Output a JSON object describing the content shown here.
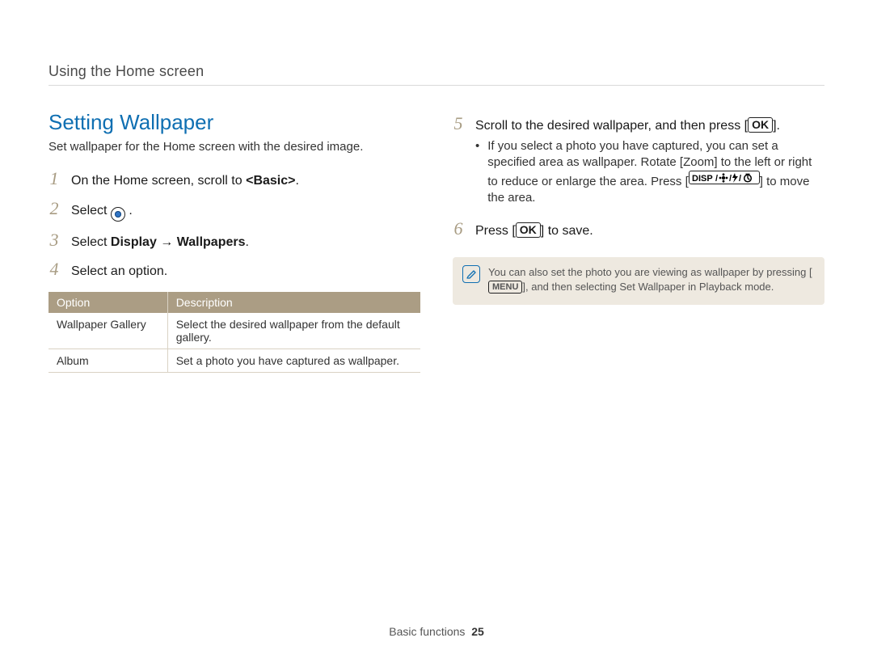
{
  "page": {
    "breadcrumb": "Using the Home screen",
    "footer_section": "Basic functions",
    "footer_page": "25"
  },
  "left": {
    "heading": "Setting Wallpaper",
    "intro": "Set wallpaper for the Home screen with the desired image.",
    "steps": {
      "s1_num": "1",
      "s1_text_a": "On the Home screen, scroll to ",
      "s1_text_b": "<Basic>",
      "s1_text_c": ".",
      "s2_num": "2",
      "s2_text_a": "Select ",
      "s2_text_b": ".",
      "s3_num": "3",
      "s3_text_a": "Select ",
      "s3_bold_a": "Display",
      "s3_arrow": " → ",
      "s3_bold_b": "Wallpapers",
      "s3_text_b": ".",
      "s4_num": "4",
      "s4_text": "Select an option."
    },
    "table": {
      "header_option": "Option",
      "header_desc": "Description",
      "rows": [
        {
          "option": "Wallpaper Gallery",
          "desc": "Select the desired wallpaper from the default gallery."
        },
        {
          "option": "Album",
          "desc": "Set a photo you have captured as wallpaper."
        }
      ]
    }
  },
  "right": {
    "s5_num": "5",
    "s5_text_a": "Scroll to the desired wallpaper, and then press [",
    "s5_key": "OK",
    "s5_text_b": "].",
    "s5_bullet_a": "If you select a photo you have captured, you can set a specified area as wallpaper. Rotate [",
    "s5_bullet_zoom": "Zoom",
    "s5_bullet_b": "] to the left or right to reduce or enlarge the area. Press [",
    "s5_bullet_disp": "DISP",
    "s5_bullet_c": "] to move the area.",
    "s6_num": "6",
    "s6_text_a": "Press [",
    "s6_key": "OK",
    "s6_text_b": "] to save.",
    "tip_a": "You can also set the photo you are viewing as wallpaper by pressing [",
    "tip_menu": "MENU",
    "tip_b": "], and then selecting ",
    "tip_bold": "Set Wallpaper",
    "tip_c": " in Playback mode."
  }
}
